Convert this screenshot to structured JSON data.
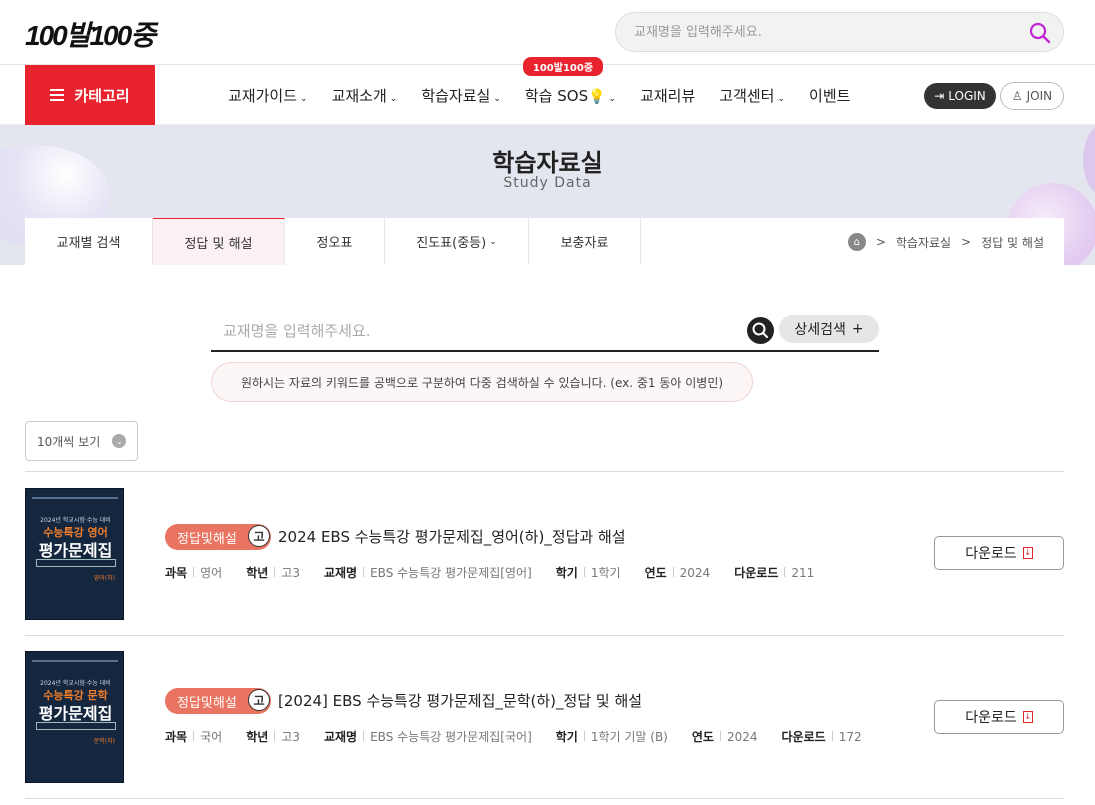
{
  "header": {
    "logo_text": "100발100중",
    "search_placeholder": "교재명을 입력해주세요."
  },
  "nav": {
    "category_label": "카테고리",
    "items": [
      {
        "label": "교재가이드",
        "has_dropdown": true
      },
      {
        "label": "교재소개",
        "has_dropdown": true
      },
      {
        "label": "학습자료실",
        "has_dropdown": true
      },
      {
        "label": "학습 SOS",
        "has_dropdown": true,
        "badge": "100발100중"
      },
      {
        "label": "교재리뷰",
        "has_dropdown": false
      },
      {
        "label": "고객센터",
        "has_dropdown": true
      },
      {
        "label": "이벤트",
        "has_dropdown": false
      }
    ],
    "login_label": "LOGIN",
    "join_label": "JOIN"
  },
  "hero": {
    "title": "학습자료실",
    "subtitle": "Study Data"
  },
  "subtabs": [
    {
      "label": "교재별 검색",
      "active": false
    },
    {
      "label": "정답 및 해설",
      "active": true
    },
    {
      "label": "정오표",
      "active": false
    },
    {
      "label": "진도표(중등)",
      "active": false
    },
    {
      "label": "보충자료",
      "active": false
    }
  ],
  "breadcrumb": [
    "학습자료실",
    "정답 및 해설"
  ],
  "search": {
    "placeholder": "교재명을 입력해주세요.",
    "advanced_label": "상세검색",
    "tip": "원하시는 자료의 키워드를 공백으로 구분하여 다중 검색하실 수 있습니다. (ex. 중1 동아 이병민)"
  },
  "list": {
    "per_page_label": "10개씩 보기",
    "items": [
      {
        "tag": "정답및해설",
        "level": "고",
        "title": "2024 EBS 수능특강 평가문제집_영어(하)_정답과 해설",
        "cover": {
          "year_line": "2024년 학교시험·수능 대비",
          "series": "수능특강 영어",
          "name": "평가문제집",
          "corner": "영어(하)"
        },
        "meta": [
          {
            "k": "과목",
            "v": "영어"
          },
          {
            "k": "학년",
            "v": "고3"
          },
          {
            "k": "교재명",
            "v": "EBS 수능특강 평가문제집[영어]"
          },
          {
            "k": "학기",
            "v": "1학기"
          },
          {
            "k": "연도",
            "v": "2024"
          },
          {
            "k": "다운로드",
            "v": "211"
          }
        ],
        "download_label": "다운로드"
      },
      {
        "tag": "정답및해설",
        "level": "고",
        "title": "[2024] EBS 수능특강 평가문제집_문학(하)_정답 및 해설",
        "cover": {
          "year_line": "2024년 학교시험·수능 대비",
          "series": "수능특강 문학",
          "name": "평가문제집",
          "corner": "문학(하)"
        },
        "meta": [
          {
            "k": "과목",
            "v": "국어"
          },
          {
            "k": "학년",
            "v": "고3"
          },
          {
            "k": "교재명",
            "v": "EBS 수능특강 평가문제집[국어]"
          },
          {
            "k": "학기",
            "v": "1학기 기말 (B)"
          },
          {
            "k": "연도",
            "v": "2024"
          },
          {
            "k": "다운로드",
            "v": "172"
          }
        ],
        "download_label": "다운로드"
      }
    ]
  },
  "colors": {
    "accent": "#e8232e",
    "tag": "#e97461"
  }
}
